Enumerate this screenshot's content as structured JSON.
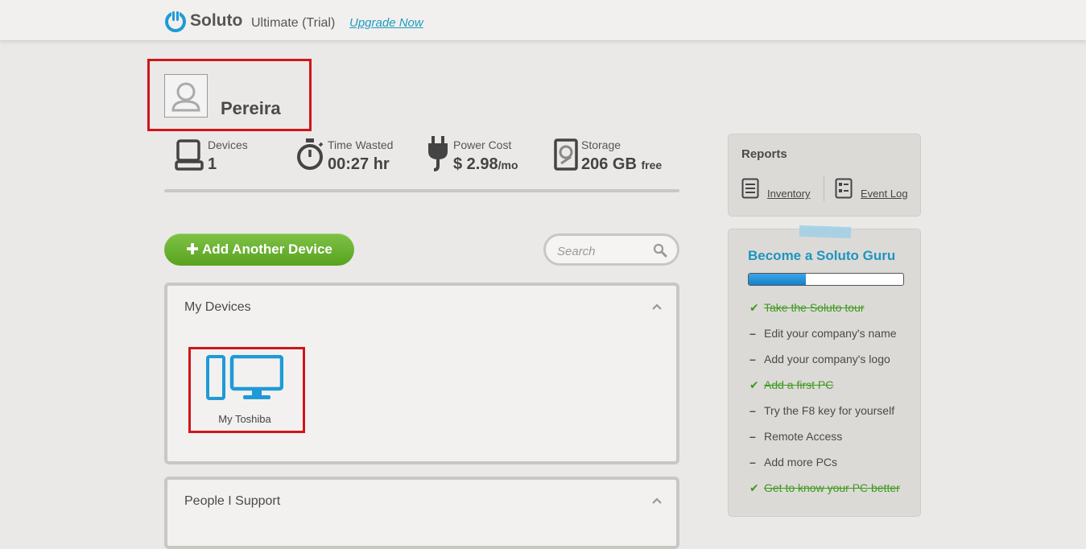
{
  "header": {
    "logo_text": "Soluto",
    "plan_text": "Ultimate (Trial)",
    "upgrade_link": "Upgrade Now"
  },
  "user": {
    "name": "Pereira",
    "avatar_icon": "user-avatar-icon"
  },
  "stats": [
    {
      "label": "Devices",
      "value": "1",
      "unit": "",
      "icon": "computer-icon"
    },
    {
      "label": "Time Wasted",
      "value": "00:27 hr",
      "unit": "",
      "icon": "stopwatch-icon"
    },
    {
      "label": "Power Cost",
      "value": "$ 2.98",
      "unit": "/mo",
      "icon": "plug-icon"
    },
    {
      "label": "Storage",
      "value": "206 GB",
      "unit": "free",
      "icon": "hard-drive-icon"
    }
  ],
  "actions": {
    "add_device_label": "Add Another Device",
    "search_placeholder": "Search"
  },
  "panels": {
    "my_devices": {
      "title": "My Devices",
      "devices": [
        {
          "name": "My Toshiba",
          "icon": "desktop-pc-icon"
        }
      ]
    },
    "people_support": {
      "title": "People I Support"
    }
  },
  "reports": {
    "title": "Reports",
    "links": [
      {
        "label": "Inventory",
        "icon": "list-icon"
      },
      {
        "label": "Event Log",
        "icon": "checklist-icon"
      }
    ]
  },
  "guru": {
    "title": "Become a Soluto Guru",
    "progress": 0.37,
    "tasks": [
      {
        "label": "Take the Soluto tour",
        "done": true
      },
      {
        "label": "Edit your company's name",
        "done": false
      },
      {
        "label": "Add your company's logo",
        "done": false
      },
      {
        "label": "Add a first PC",
        "done": true
      },
      {
        "label": "Try the F8 key for yourself",
        "done": false
      },
      {
        "label": "Remote Access",
        "done": false
      },
      {
        "label": "Add more PCs",
        "done": false
      },
      {
        "label": "Get to know your PC better",
        "done": true
      }
    ]
  },
  "colors": {
    "accent_blue": "#1d95c0",
    "device_blue": "#1f9ad6",
    "green_button": "#6ab232",
    "done_green": "#3e9a1f",
    "highlight_red": "#d0151b"
  }
}
